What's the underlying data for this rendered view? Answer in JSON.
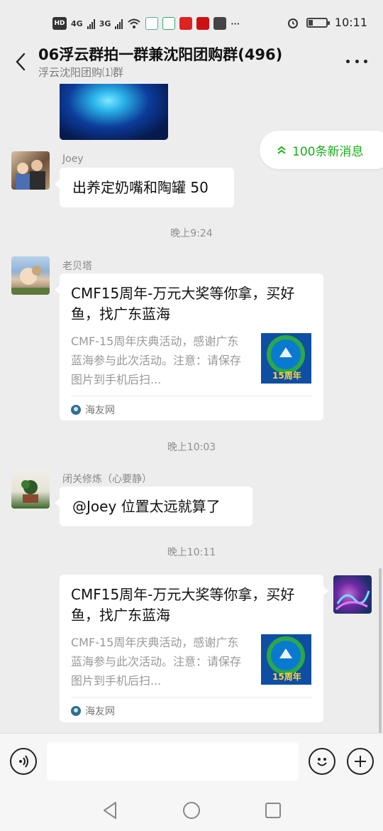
{
  "status_bar": {
    "time": "10:11",
    "left_labels": [
      "HD",
      "4G",
      "3G"
    ],
    "more": "···",
    "battery_level": 0.25
  },
  "header": {
    "title": "06浮云群拍一群兼沈阳团购群(496)",
    "subtitle": "浮云沈阳团购⑴群",
    "back_icon": "chevron-left-icon",
    "more_icon": "more-dots-icon"
  },
  "new_messages": {
    "label": "100条新消息",
    "icon": "double-chevron-up-icon"
  },
  "messages": [
    {
      "type": "image",
      "side": "left",
      "image": "blue-glowing-coral-photo"
    },
    {
      "type": "text",
      "side": "left",
      "sender": "Joey",
      "text": "出养定奶嘴和陶罐 50"
    },
    {
      "type": "time",
      "text": "晚上9:24"
    },
    {
      "type": "link",
      "side": "left",
      "sender": "老贝塔",
      "title": "CMF15周年-万元大奖等你拿，买好鱼，找广东蓝海",
      "desc": "CMF-15周年庆典活动，感谢广东蓝海参与此次活动。注意：请保存图片到手机后扫...",
      "source": "海友网",
      "thumb_badge": "15周年"
    },
    {
      "type": "time",
      "text": "晚上10:03"
    },
    {
      "type": "text",
      "side": "left",
      "sender": "闭关修炼（心要静）",
      "text": "@Joey  位置太远就算了"
    },
    {
      "type": "time",
      "text": "晚上10:11"
    },
    {
      "type": "link",
      "side": "right",
      "title": "CMF15周年-万元大奖等你拿，买好鱼，找广东蓝海",
      "desc": "CMF-15周年庆典活动，感谢广东蓝海参与此次活动。注意：请保存图片到手机后扫...",
      "source": "海友网",
      "thumb_badge": "15周年"
    }
  ],
  "input_bar": {
    "voice_icon": "voice-icon",
    "emoji_icon": "emoji-icon",
    "plus_icon": "plus-icon",
    "placeholder": ""
  },
  "nav_bar": {
    "back": "back-triangle-icon",
    "home": "home-circle-icon",
    "recents": "recents-square-icon"
  },
  "colors": {
    "accent_green": "#1aad19",
    "chat_bg": "#ededed",
    "bubble": "#ffffff"
  }
}
